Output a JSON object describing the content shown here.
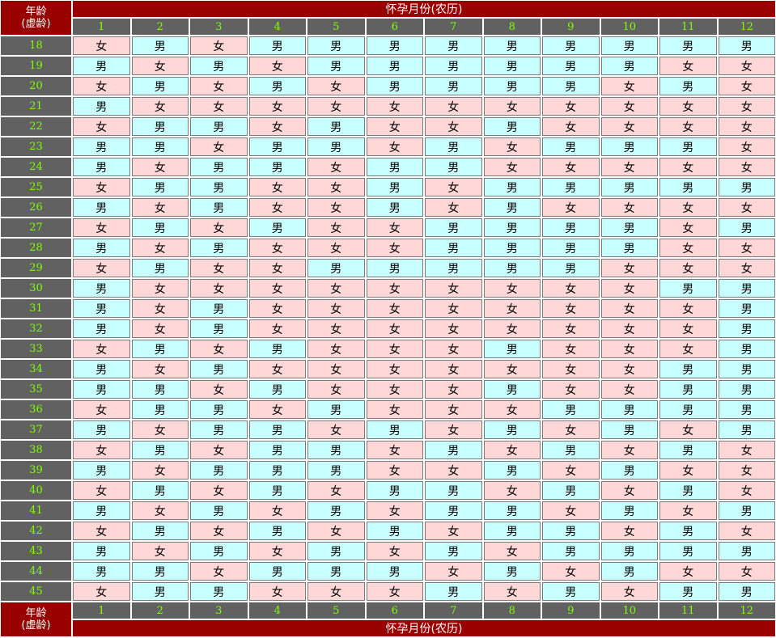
{
  "header": {
    "age_label_line1": "年龄",
    "age_label_line2": "(虚龄)",
    "title": "怀孕月份(农历)"
  },
  "months": [
    "1",
    "2",
    "3",
    "4",
    "5",
    "6",
    "7",
    "8",
    "9",
    "10",
    "11",
    "12"
  ],
  "colors": {
    "girl": "#ffd7d7",
    "boy": "#c8ffff",
    "header_red": "#990000",
    "label_gray": "#616161",
    "label_green": "#7fff00"
  },
  "rows": [
    {
      "age": "18",
      "values": [
        "女",
        "男",
        "女",
        "男",
        "男",
        "男",
        "男",
        "男",
        "男",
        "男",
        "男",
        "男"
      ]
    },
    {
      "age": "19",
      "values": [
        "男",
        "女",
        "男",
        "女",
        "男",
        "男",
        "男",
        "男",
        "男",
        "男",
        "女",
        "女"
      ]
    },
    {
      "age": "20",
      "values": [
        "女",
        "男",
        "女",
        "男",
        "女",
        "男",
        "男",
        "男",
        "男",
        "女",
        "男",
        "女"
      ]
    },
    {
      "age": "21",
      "values": [
        "男",
        "女",
        "女",
        "女",
        "女",
        "女",
        "女",
        "女",
        "女",
        "女",
        "女",
        "女"
      ]
    },
    {
      "age": "22",
      "values": [
        "女",
        "男",
        "男",
        "女",
        "男",
        "女",
        "女",
        "男",
        "女",
        "女",
        "女",
        "女"
      ]
    },
    {
      "age": "23",
      "values": [
        "男",
        "男",
        "女",
        "男",
        "男",
        "女",
        "男",
        "女",
        "男",
        "男",
        "男",
        "女"
      ]
    },
    {
      "age": "24",
      "values": [
        "男",
        "女",
        "男",
        "男",
        "女",
        "男",
        "男",
        "女",
        "女",
        "女",
        "女",
        "女"
      ]
    },
    {
      "age": "25",
      "values": [
        "女",
        "男",
        "男",
        "女",
        "女",
        "男",
        "女",
        "男",
        "男",
        "男",
        "男",
        "男"
      ]
    },
    {
      "age": "26",
      "values": [
        "男",
        "女",
        "男",
        "女",
        "女",
        "男",
        "女",
        "男",
        "女",
        "女",
        "女",
        "女"
      ]
    },
    {
      "age": "27",
      "values": [
        "女",
        "男",
        "女",
        "男",
        "女",
        "女",
        "男",
        "男",
        "男",
        "男",
        "女",
        "男"
      ]
    },
    {
      "age": "28",
      "values": [
        "男",
        "女",
        "男",
        "女",
        "女",
        "女",
        "男",
        "男",
        "男",
        "男",
        "女",
        "女"
      ]
    },
    {
      "age": "29",
      "values": [
        "女",
        "男",
        "女",
        "女",
        "男",
        "男",
        "男",
        "男",
        "男",
        "女",
        "女",
        "女"
      ]
    },
    {
      "age": "30",
      "values": [
        "男",
        "女",
        "女",
        "女",
        "女",
        "女",
        "女",
        "女",
        "女",
        "女",
        "男",
        "男"
      ]
    },
    {
      "age": "31",
      "values": [
        "男",
        "女",
        "男",
        "女",
        "女",
        "女",
        "女",
        "女",
        "女",
        "女",
        "女",
        "男"
      ]
    },
    {
      "age": "32",
      "values": [
        "男",
        "女",
        "男",
        "女",
        "女",
        "女",
        "女",
        "女",
        "女",
        "女",
        "女",
        "男"
      ]
    },
    {
      "age": "33",
      "values": [
        "女",
        "男",
        "女",
        "男",
        "女",
        "女",
        "女",
        "男",
        "女",
        "女",
        "女",
        "男"
      ]
    },
    {
      "age": "34",
      "values": [
        "男",
        "女",
        "男",
        "女",
        "女",
        "女",
        "女",
        "女",
        "女",
        "女",
        "男",
        "男"
      ]
    },
    {
      "age": "35",
      "values": [
        "男",
        "男",
        "女",
        "男",
        "女",
        "女",
        "女",
        "男",
        "女",
        "女",
        "男",
        "男"
      ]
    },
    {
      "age": "36",
      "values": [
        "女",
        "男",
        "男",
        "女",
        "男",
        "女",
        "女",
        "女",
        "男",
        "男",
        "男",
        "男"
      ]
    },
    {
      "age": "37",
      "values": [
        "男",
        "女",
        "男",
        "男",
        "女",
        "男",
        "女",
        "男",
        "女",
        "男",
        "女",
        "男"
      ]
    },
    {
      "age": "38",
      "values": [
        "女",
        "男",
        "女",
        "男",
        "男",
        "女",
        "男",
        "女",
        "男",
        "女",
        "男",
        "女"
      ]
    },
    {
      "age": "39",
      "values": [
        "男",
        "女",
        "男",
        "男",
        "男",
        "女",
        "女",
        "男",
        "女",
        "男",
        "女",
        "女"
      ]
    },
    {
      "age": "40",
      "values": [
        "女",
        "男",
        "女",
        "男",
        "女",
        "男",
        "男",
        "女",
        "男",
        "女",
        "男",
        "女"
      ]
    },
    {
      "age": "41",
      "values": [
        "男",
        "女",
        "男",
        "女",
        "男",
        "女",
        "男",
        "男",
        "女",
        "男",
        "女",
        "男"
      ]
    },
    {
      "age": "42",
      "values": [
        "女",
        "男",
        "女",
        "男",
        "女",
        "男",
        "女",
        "男",
        "男",
        "女",
        "男",
        "女"
      ]
    },
    {
      "age": "43",
      "values": [
        "男",
        "女",
        "男",
        "女",
        "男",
        "女",
        "男",
        "女",
        "男",
        "男",
        "男",
        "男"
      ]
    },
    {
      "age": "44",
      "values": [
        "男",
        "男",
        "女",
        "男",
        "男",
        "男",
        "女",
        "男",
        "女",
        "男",
        "女",
        "女"
      ]
    },
    {
      "age": "45",
      "values": [
        "女",
        "男",
        "男",
        "女",
        "女",
        "女",
        "男",
        "女",
        "男",
        "女",
        "男",
        "男"
      ]
    }
  ]
}
